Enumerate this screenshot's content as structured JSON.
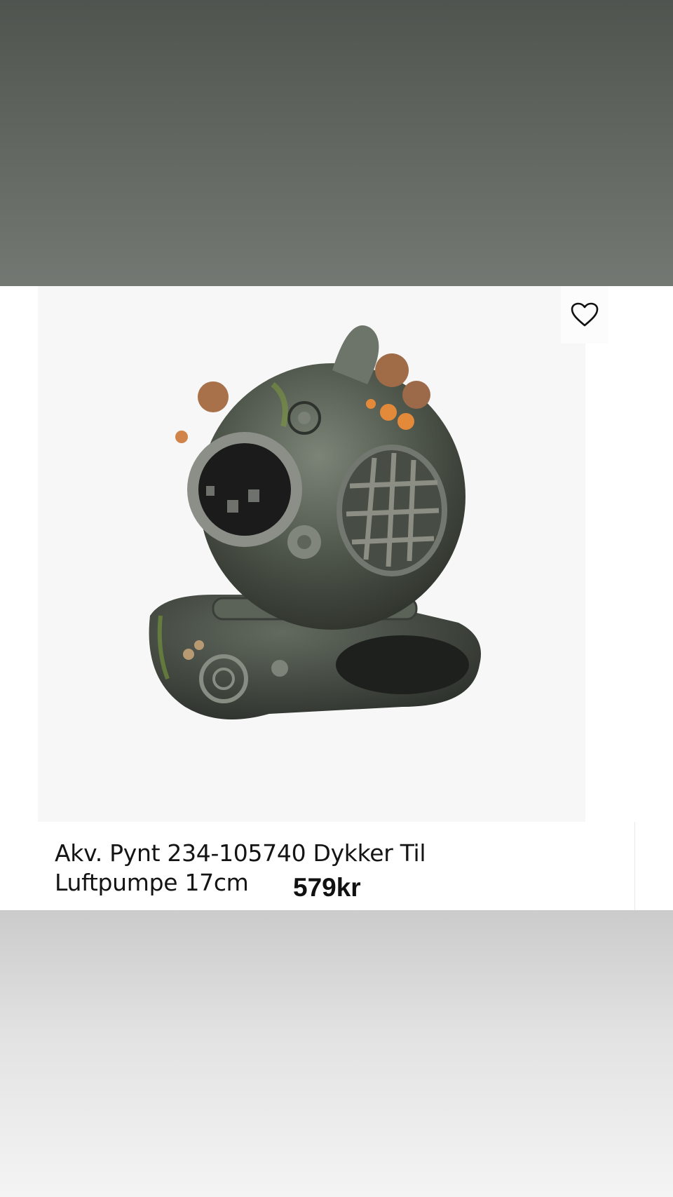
{
  "product": {
    "title": "Akv. Pynt 234-105740 Dykker Til Luftpumpe 17cm",
    "price": "579kr",
    "image_alt": "diving helmet aquarium ornament"
  },
  "icons": {
    "favorite": "heart-outline-icon"
  },
  "colors": {
    "top_overlay": "#5e635d",
    "bottom_overlay": "#e3e3e3",
    "image_background": "#f7f7f8",
    "text": "#141414"
  }
}
